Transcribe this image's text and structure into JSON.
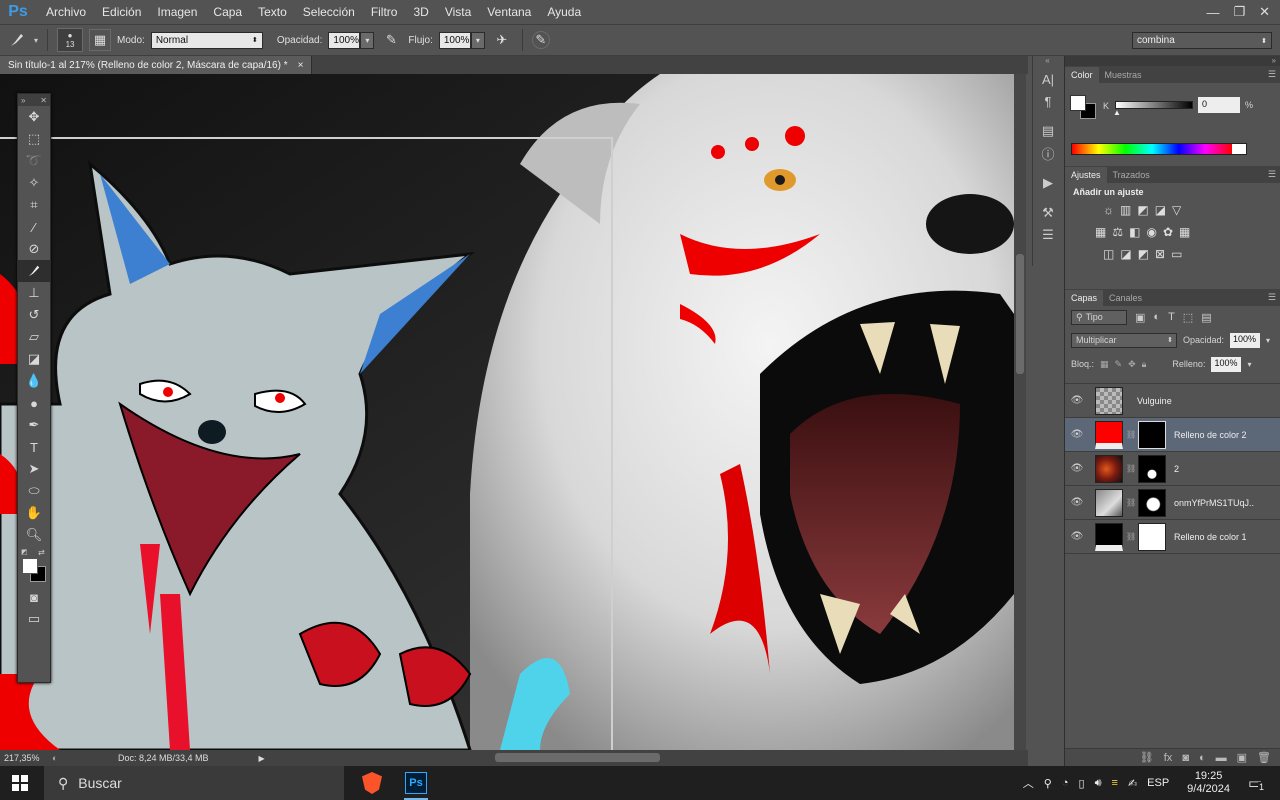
{
  "menubar": {
    "logo": "Ps",
    "items": [
      "Archivo",
      "Edición",
      "Imagen",
      "Capa",
      "Texto",
      "Selección",
      "Filtro",
      "3D",
      "Vista",
      "Ventana",
      "Ayuda"
    ],
    "window_controls": [
      "—",
      "❐",
      "✕"
    ]
  },
  "options": {
    "brush_size": "13",
    "mode_label": "Modo:",
    "mode_value": "Normal",
    "opacity_label": "Opacidad:",
    "opacity_value": "100%",
    "flow_label": "Flujo:",
    "flow_value": "100%",
    "workspace_value": "combina"
  },
  "document": {
    "tab_title": "Sin título-1 al 217% (Relleno de color 2, Máscara de capa/16) *",
    "close": "×",
    "zoom": "217,35%",
    "doc_info": "Doc: 8,24 MB/33,4 MB"
  },
  "color_panel": {
    "tabs": [
      "Color",
      "Muestras"
    ],
    "channel_label": "K",
    "channel_value": "0",
    "unit": "%"
  },
  "adjustments_panel": {
    "tabs": [
      "Ajustes",
      "Trazados"
    ],
    "heading": "Añadir un ajuste"
  },
  "layers_panel": {
    "tabs": [
      "Capas",
      "Canales"
    ],
    "filter_label": "Tipo",
    "blend_mode": "Multiplicar",
    "opacity_label": "Opacidad:",
    "opacity_value": "100%",
    "lock_label": "Bloq.:",
    "fill_label": "Relleno:",
    "fill_value": "100%",
    "layers": [
      {
        "name": "Vulguine",
        "selected": false
      },
      {
        "name": "Relleno de color 2",
        "selected": true
      },
      {
        "name": "2",
        "selected": false
      },
      {
        "name": "onmYfPrMS1TUqJ...",
        "selected": false
      },
      {
        "name": "Relleno de color 1",
        "selected": false
      }
    ]
  },
  "taskbar": {
    "search_placeholder": "Buscar",
    "language": "ESP",
    "time": "19:25",
    "date": "9/4/2024",
    "notification_count": "1"
  },
  "colors": {
    "ui_bg": "#535353",
    "panel_dark": "#424242",
    "selection": "#5c6778",
    "red_fill": "#ff0000",
    "ps_blue": "#3d9be8"
  }
}
